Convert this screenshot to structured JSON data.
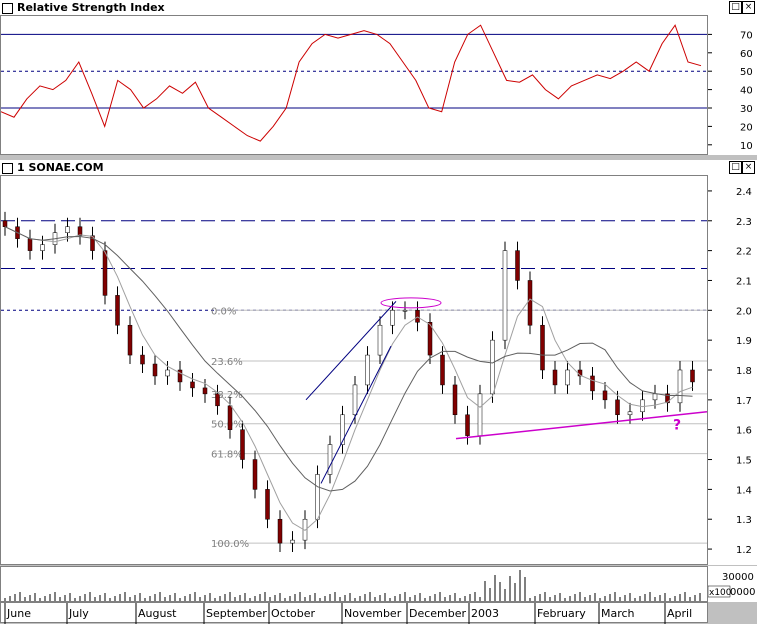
{
  "rsi_panel": {
    "title": "Relative Strength Index",
    "ticks": [
      "70",
      "60",
      "50",
      "40",
      "30",
      "20",
      "10"
    ]
  },
  "price_panel": {
    "title": "1 SONAE.COM",
    "ticks": [
      "2.4",
      "2.3",
      "2.2",
      "2.1",
      "2.0",
      "1.9",
      "1.8",
      "1.7",
      "1.6",
      "1.5",
      "1.4",
      "1.3",
      "1.2"
    ]
  },
  "volume_panel": {
    "ticks": [
      "30000"
    ],
    "multiplier": "x100"
  },
  "month_labels": [
    "June",
    "July",
    "August",
    "September",
    "October",
    "November",
    "December",
    "2003",
    "February",
    "March",
    "April"
  ],
  "fib_labels": [
    "0.0%",
    "23.6%",
    "38.2%",
    "50.0%",
    "61.8%",
    "100.0%"
  ],
  "annotation": "?",
  "colors": {
    "candle_up": "#ffffff",
    "candle_down": "#800000",
    "rsi_line": "#cc0000",
    "guide_line": "#000080",
    "pink": "#cc00cc",
    "ma": "#808080"
  },
  "chart_data": {
    "type": "candlestick",
    "title": "1 SONAE.COM",
    "ylim": [
      1.15,
      2.45
    ],
    "x_range": [
      "June 2002",
      "April 2003"
    ],
    "closes_approx": [
      2.28,
      2.24,
      2.2,
      2.22,
      2.26,
      2.28,
      2.25,
      2.2,
      2.05,
      1.95,
      1.85,
      1.82,
      1.78,
      1.8,
      1.76,
      1.74,
      1.72,
      1.68,
      1.6,
      1.5,
      1.4,
      1.3,
      1.22,
      1.23,
      1.3,
      1.45,
      1.55,
      1.65,
      1.75,
      1.85,
      1.95,
      2.0,
      2.0,
      1.96,
      1.85,
      1.75,
      1.65,
      1.58,
      1.72,
      1.9,
      2.2,
      2.1,
      1.95,
      1.8,
      1.75,
      1.8,
      1.78,
      1.73,
      1.7,
      1.65,
      1.66,
      1.7,
      1.72,
      1.69,
      1.8,
      1.76
    ],
    "horizontal_levels": [
      2.3,
      2.14,
      2.0
    ],
    "rsi": {
      "ylim": [
        5,
        80
      ],
      "levels": [
        70,
        50,
        30
      ],
      "values_approx": [
        28,
        25,
        35,
        42,
        40,
        45,
        55,
        38,
        20,
        45,
        40,
        30,
        35,
        42,
        38,
        44,
        30,
        25,
        20,
        15,
        12,
        20,
        30,
        55,
        65,
        70,
        68,
        70,
        72,
        70,
        65,
        55,
        45,
        30,
        28,
        55,
        70,
        75,
        60,
        45,
        44,
        48,
        40,
        35,
        42,
        45,
        48,
        46,
        50,
        55,
        50,
        65,
        75,
        55,
        53
      ]
    },
    "volume": {
      "unit": "x100",
      "ticks": [
        30000
      ]
    },
    "fibonacci": [
      {
        "label": "0.0%",
        "value": 2.0
      },
      {
        "label": "23.6%",
        "value": 1.83
      },
      {
        "label": "38.2%",
        "value": 1.72
      },
      {
        "label": "50.0%",
        "value": 1.62
      },
      {
        "label": "61.8%",
        "value": 1.52
      },
      {
        "label": "100.0%",
        "value": 1.22
      }
    ]
  }
}
